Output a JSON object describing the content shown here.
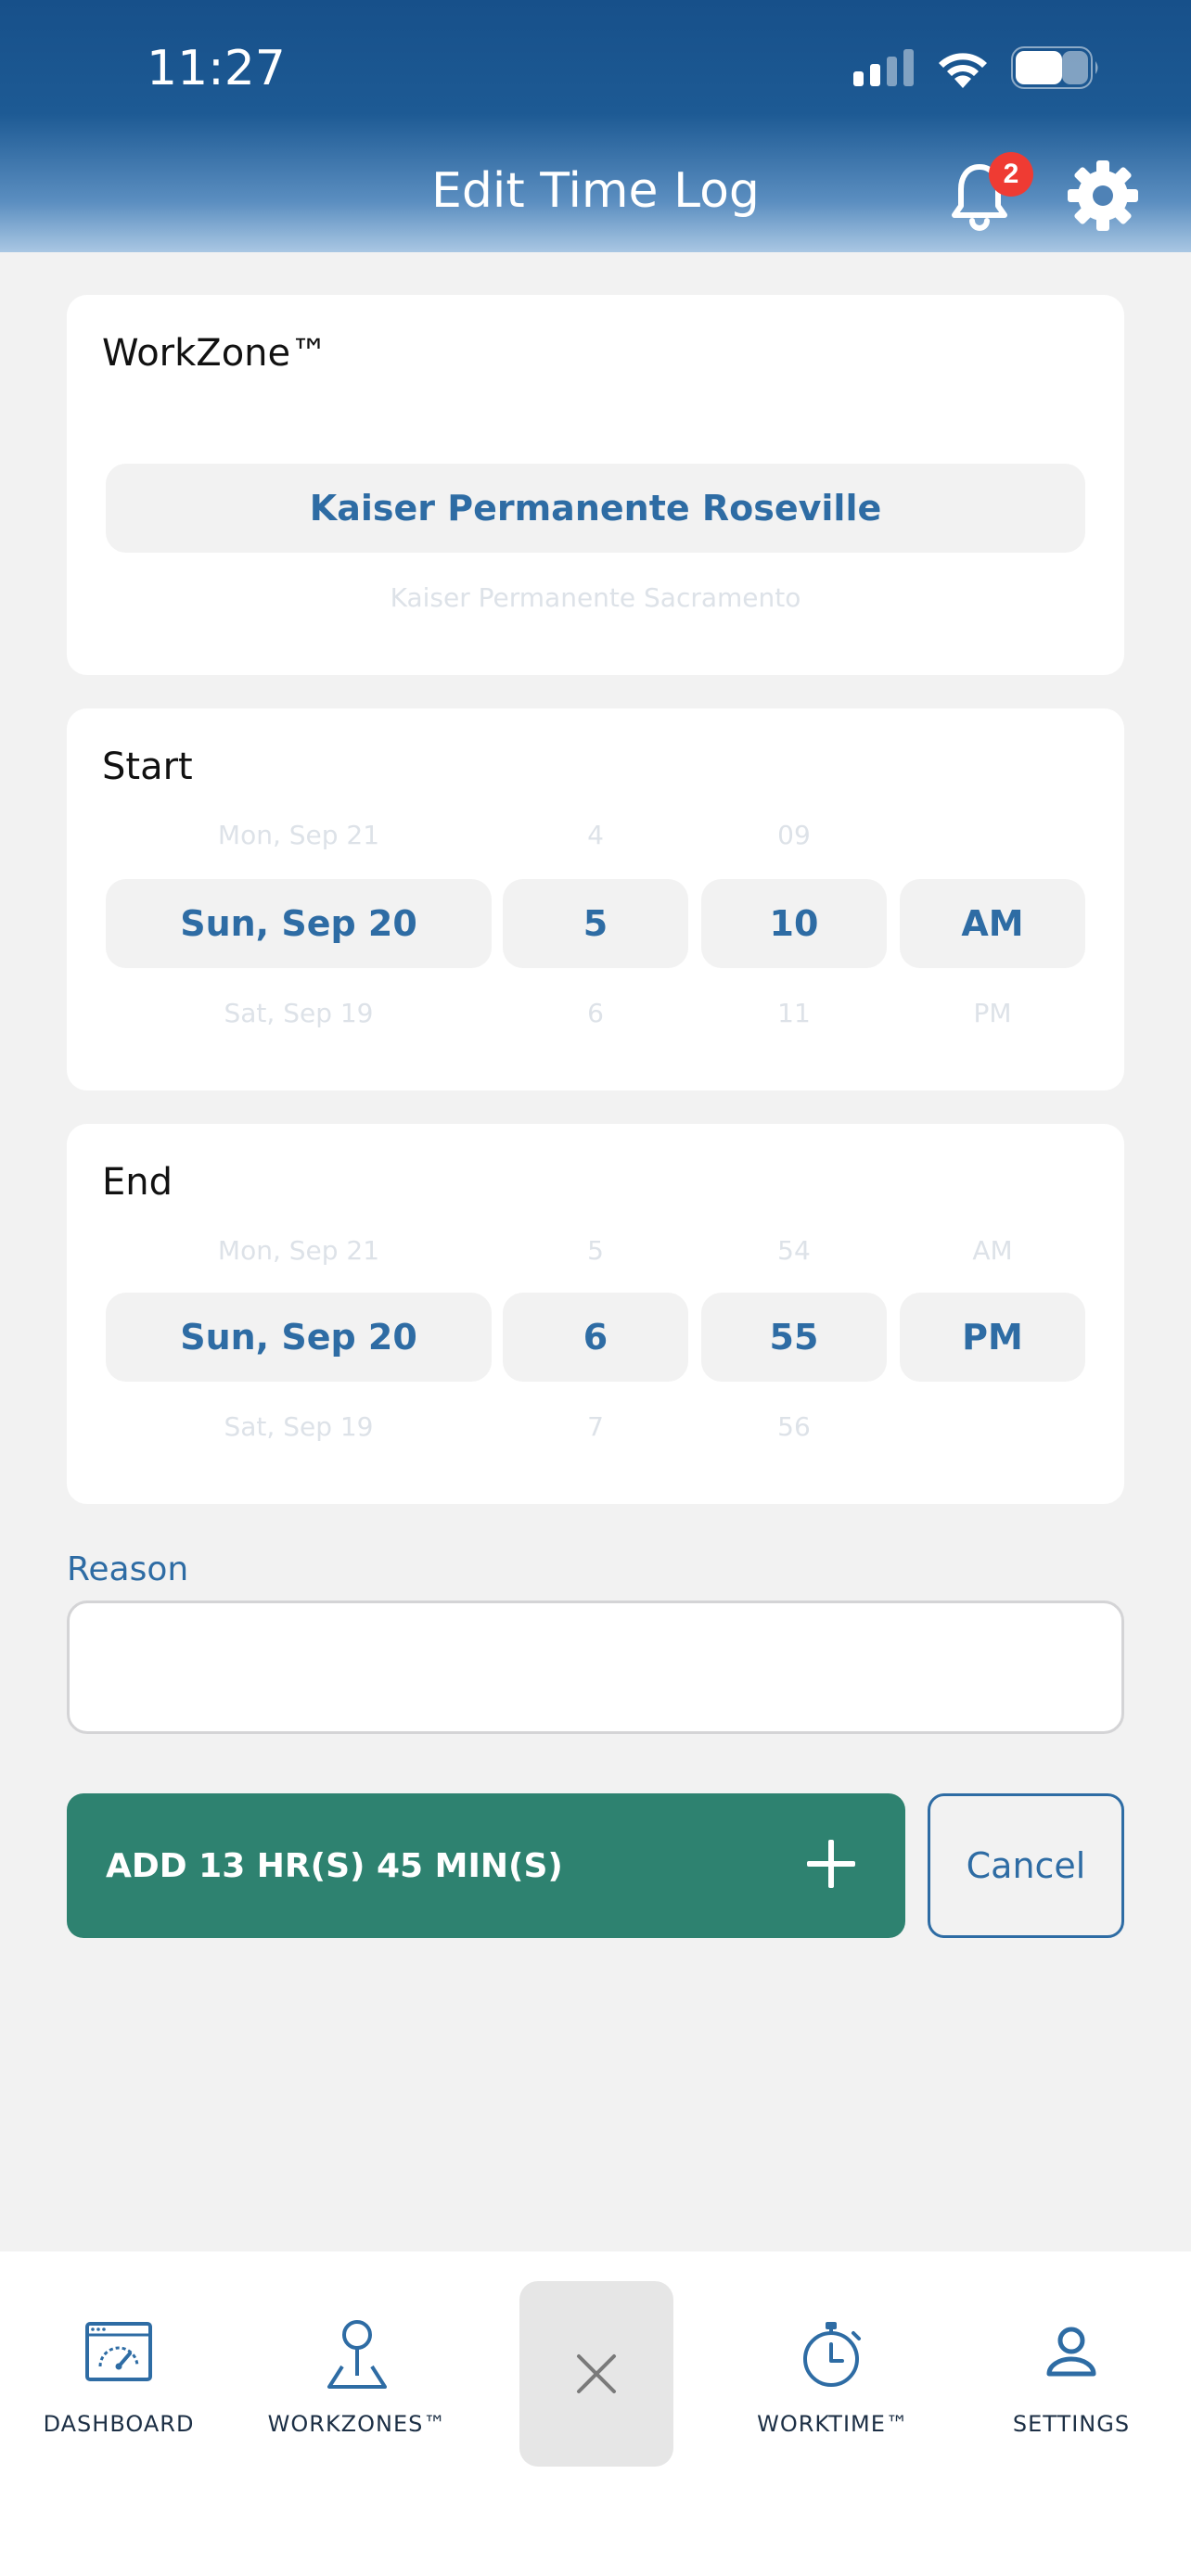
{
  "status_bar": {
    "time": "11:27"
  },
  "header": {
    "title": "Edit Time Log",
    "notification_count": "2"
  },
  "workzone": {
    "title": "WorkZone™",
    "selected": "Kaiser Permanente Roseville",
    "next_option": "Kaiser Permanente Sacramento"
  },
  "start": {
    "title": "Start",
    "date": {
      "above": "Mon, Sep 21",
      "selected": "Sun, Sep 20",
      "below": "Sat, Sep 19"
    },
    "hour": {
      "above": "4",
      "selected": "5",
      "below": "6"
    },
    "minute": {
      "above": "09",
      "selected": "10",
      "below": "11"
    },
    "ampm": {
      "above": "",
      "selected": "AM",
      "below": "PM"
    }
  },
  "end": {
    "title": "End",
    "date": {
      "above": "Mon, Sep 21",
      "selected": "Sun, Sep 20",
      "below": "Sat, Sep 19"
    },
    "hour": {
      "above": "5",
      "selected": "6",
      "below": "7"
    },
    "minute": {
      "above": "54",
      "selected": "55",
      "below": "56"
    },
    "ampm": {
      "above": "AM",
      "selected": "PM",
      "below": ""
    }
  },
  "reason": {
    "label": "Reason",
    "value": "",
    "placeholder": ""
  },
  "actions": {
    "add_label": "ADD 13 HR(S) 45 MIN(S)",
    "cancel_label": "Cancel"
  },
  "tabbar": {
    "dashboard": "DASHBOARD",
    "workzones": "WORKZONES™",
    "worktime": "WORKTIME™",
    "settings": "SETTINGS"
  },
  "colors": {
    "brand_blue": "#2e6ca4",
    "add_green": "#2e8270",
    "badge_red": "#ef3b33"
  }
}
